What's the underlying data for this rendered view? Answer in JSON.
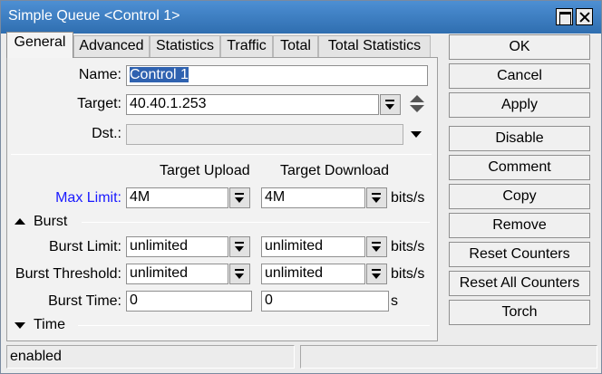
{
  "window": {
    "title": "Simple Queue <Control 1>"
  },
  "tabs": [
    {
      "label": "General",
      "active": true
    },
    {
      "label": "Advanced",
      "active": false
    },
    {
      "label": "Statistics",
      "active": false
    },
    {
      "label": "Traffic",
      "active": false
    },
    {
      "label": "Total",
      "active": false
    },
    {
      "label": "Total Statistics",
      "active": false
    }
  ],
  "general": {
    "name_label": "Name:",
    "name_value": "Control 1",
    "target_label": "Target:",
    "target_value": "40.40.1.253",
    "dst_label": "Dst.:",
    "dst_value": "",
    "col_upload": "Target Upload",
    "col_download": "Target Download",
    "max_limit_label": "Max Limit:",
    "max_limit_upload": "4M",
    "max_limit_download": "4M",
    "unit_bits": "bits/s",
    "burst_section": "Burst",
    "burst_limit_label": "Burst Limit:",
    "burst_limit_upload": "unlimited",
    "burst_limit_download": "unlimited",
    "burst_threshold_label": "Burst Threshold:",
    "burst_threshold_upload": "unlimited",
    "burst_threshold_download": "unlimited",
    "burst_time_label": "Burst Time:",
    "burst_time_upload": "0",
    "burst_time_download": "0",
    "unit_seconds": "s",
    "time_section": "Time"
  },
  "buttons": {
    "ok": "OK",
    "cancel": "Cancel",
    "apply": "Apply",
    "disable": "Disable",
    "comment": "Comment",
    "copy": "Copy",
    "remove": "Remove",
    "reset_counters": "Reset Counters",
    "reset_all_counters": "Reset All Counters",
    "torch": "Torch"
  },
  "status": {
    "state": "enabled",
    "extra": ""
  },
  "colors": {
    "titlebar": "#3a7cc0",
    "link_label": "#1a1aff",
    "selection": "#2f62b0"
  }
}
